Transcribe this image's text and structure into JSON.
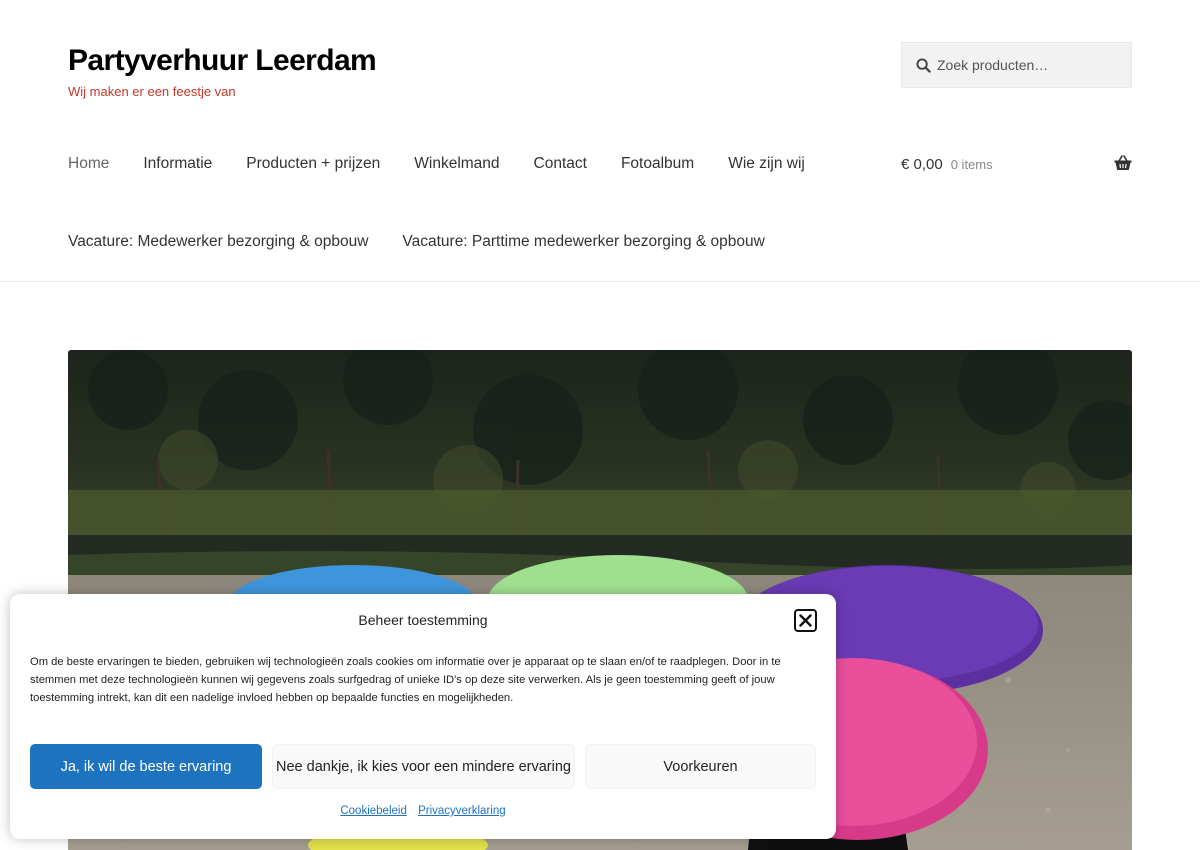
{
  "site": {
    "title": "Partyverhuur Leerdam",
    "tagline": "Wij maken er een feestje van",
    "tagline_color": "#c0392b"
  },
  "search": {
    "placeholder": "Zoek producten…",
    "icon": "search-icon"
  },
  "nav": {
    "items": [
      {
        "label": "Home",
        "current": true
      },
      {
        "label": "Informatie"
      },
      {
        "label": "Producten + prijzen"
      },
      {
        "label": "Winkelmand"
      },
      {
        "label": "Contact"
      },
      {
        "label": "Fotoalbum"
      },
      {
        "label": "Wie zijn wij"
      }
    ],
    "sub_items": [
      {
        "label": "Vacature: Medewerker bezorging & opbouw"
      },
      {
        "label": "Vacature: Parttime medewerker bezorging & opbouw"
      }
    ]
  },
  "cart": {
    "amount": "€ 0,00",
    "count": "0 items",
    "icon": "basket-icon"
  },
  "hero": {
    "image": "cocktail tables with colored covers (blue, green, purple, pink, yellow) on gravel in front of a hedge"
  },
  "consent": {
    "title": "Beheer toestemming",
    "text": "Om de beste ervaringen te bieden, gebruiken wij technologieën zoals cookies om informatie over je apparaat op te slaan en/of te raadplegen. Door in te stemmen met deze technologieën kunnen wij gegevens zoals surfgedrag of unieke ID's op deze site verwerken. Als je geen toestemming geeft of jouw toestemming intrekt, kan dit een nadelige invloed hebben op bepaalde functies en mogelijkheden.",
    "accept_label": "Ja, ik wil de beste ervaring",
    "deny_label": "Nee dankje, ik kies voor een mindere ervaring",
    "prefs_label": "Voorkeuren",
    "links": [
      "Cookiebeleid",
      "Privacyverklaring"
    ],
    "accent_color": "#1e73be"
  }
}
